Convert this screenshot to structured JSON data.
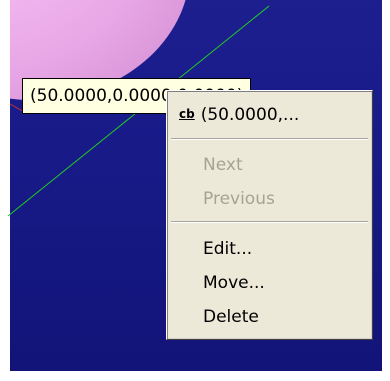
{
  "tooltip": {
    "coordinate_text": "(50.0000,0.0000,0.0000)"
  },
  "context_menu": {
    "header_icon": "cb-icon",
    "header_label": "(50.0000,...",
    "items": [
      {
        "label": "Next",
        "enabled": false
      },
      {
        "label": "Previous",
        "enabled": false
      },
      {
        "label": "Edit...",
        "enabled": true
      },
      {
        "label": "Move...",
        "enabled": true
      },
      {
        "label": "Delete",
        "enabled": true
      }
    ]
  },
  "colors": {
    "viewport_background": "#181a88",
    "solid_shape": "#e8a7e6",
    "green_axis": "#22cc22",
    "red_axis": "#cc3333",
    "tooltip_background": "#ffffe1",
    "menu_background": "#ece9d8",
    "disabled_text": "#a6a395"
  }
}
